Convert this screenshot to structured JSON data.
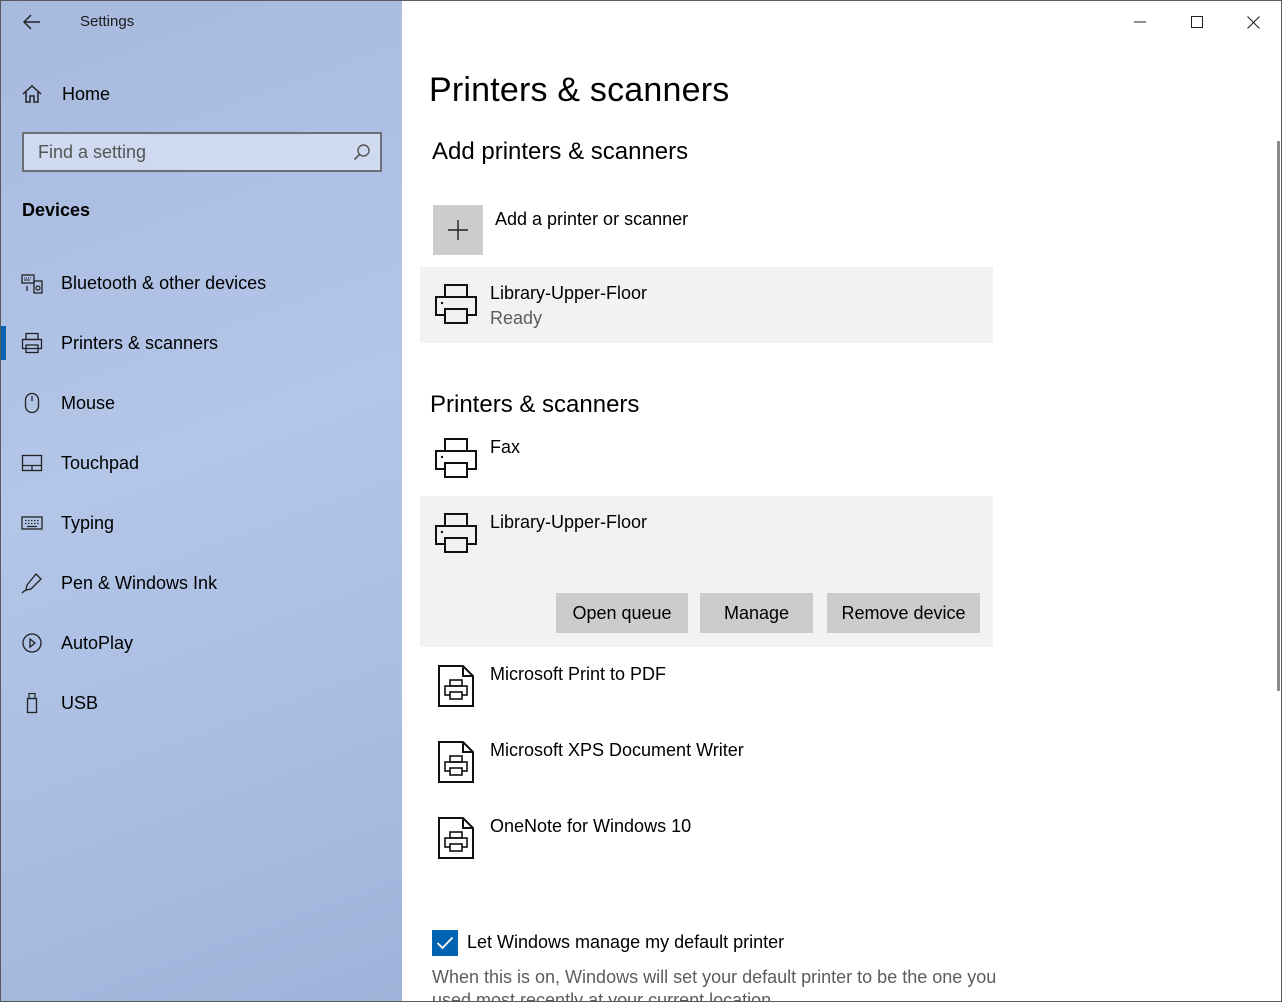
{
  "window": {
    "title": "Settings"
  },
  "sidebar": {
    "home_label": "Home",
    "search_placeholder": "Find a setting",
    "section_title": "Devices",
    "items": [
      {
        "label": "Bluetooth & other devices",
        "icon": "bluetooth-devices-icon"
      },
      {
        "label": "Printers & scanners",
        "icon": "printer-icon",
        "selected": true
      },
      {
        "label": "Mouse",
        "icon": "mouse-icon"
      },
      {
        "label": "Touchpad",
        "icon": "touchpad-icon"
      },
      {
        "label": "Typing",
        "icon": "keyboard-icon"
      },
      {
        "label": "Pen & Windows Ink",
        "icon": "pen-icon"
      },
      {
        "label": "AutoPlay",
        "icon": "autoplay-icon"
      },
      {
        "label": "USB",
        "icon": "usb-icon"
      }
    ]
  },
  "main": {
    "page_title": "Printers & scanners",
    "add_section": {
      "title": "Add printers & scanners",
      "add_label": "Add a printer or scanner",
      "found_device": {
        "name": "Library-Upper-Floor",
        "status": "Ready"
      }
    },
    "list_section": {
      "title": "Printers & scanners",
      "devices": [
        {
          "name": "Fax",
          "icon": "printer-icon"
        },
        {
          "name": "Library-Upper-Floor",
          "icon": "printer-icon",
          "expanded": true
        },
        {
          "name": "Microsoft Print to PDF",
          "icon": "document-printer-icon"
        },
        {
          "name": "Microsoft XPS Document Writer",
          "icon": "document-printer-icon"
        },
        {
          "name": "OneNote for Windows 10",
          "icon": "document-printer-icon"
        }
      ],
      "actions": {
        "open_queue": "Open queue",
        "manage": "Manage",
        "remove": "Remove device"
      }
    },
    "default_printer": {
      "checked": true,
      "label": "Let Windows manage my default printer",
      "description": "When this is on, Windows will set your default printer to be the one you used most recently at your current location."
    }
  },
  "colors": {
    "accent": "#0063b1",
    "tile": "#cccccc",
    "highlight": "#f2f2f2"
  }
}
